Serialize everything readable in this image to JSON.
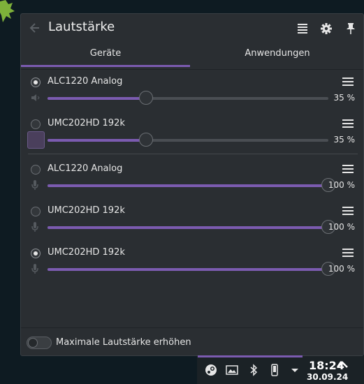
{
  "header": {
    "title": "Lautstärke"
  },
  "tabs": [
    {
      "label": "Geräte",
      "active": true
    },
    {
      "label": "Anwendungen",
      "active": false
    }
  ],
  "outputs": [
    {
      "name": "ALC1220 Analog",
      "volume": 35,
      "volume_label": "35 %",
      "selected": true,
      "muted_icon": "speaker-muted-icon"
    },
    {
      "name": "UMC202HD 192k",
      "volume": 35,
      "volume_label": "35 %",
      "selected": false
    }
  ],
  "inputs": [
    {
      "name": "ALC1220 Analog",
      "volume": 100,
      "volume_label": "100 %",
      "selected": false
    },
    {
      "name": "UMC202HD 192k",
      "volume": 100,
      "volume_label": "100 %",
      "selected": false
    },
    {
      "name": "UMC202HD 192k",
      "volume": 100,
      "volume_label": "100 %",
      "selected": true
    }
  ],
  "footer": {
    "toggle_label": "Maximale Lautstärke erhöhen",
    "toggle_on": false
  },
  "taskbar": {
    "time": "18:24",
    "date": "30.09.24"
  },
  "colors": {
    "accent": "#7b5bb0",
    "background": "#2a2e32",
    "desktop": "#0e1b22"
  }
}
